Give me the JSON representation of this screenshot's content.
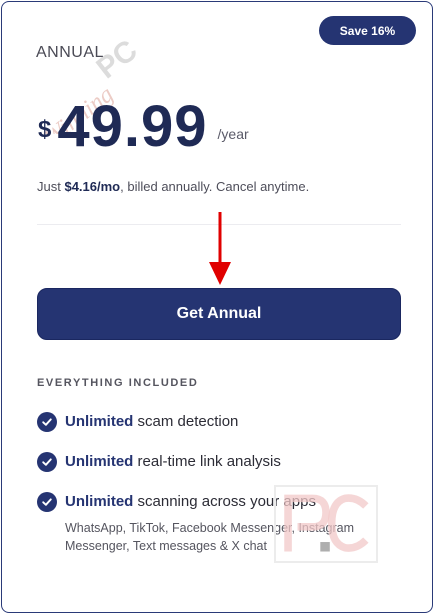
{
  "badge": {
    "label": "Save 16%"
  },
  "plan": {
    "name": "ANNUAL",
    "currency": "$",
    "price": "49.99",
    "period": "/year",
    "subtext_prefix": "Just ",
    "monthly_price": "$4.16/mo",
    "subtext_suffix": ", billed annually. Cancel anytime."
  },
  "cta": {
    "label": "Get Annual"
  },
  "included": {
    "title": "EVERYTHING INCLUDED",
    "features": [
      {
        "highlight": "Unlimited",
        "text": " scam detection"
      },
      {
        "highlight": "Unlimited",
        "text": " real-time link analysis"
      },
      {
        "highlight": "Unlimited",
        "text": " scanning across your apps",
        "subtext": "WhatsApp, TikTok, Facebook Messenger, Instagram Messenger, Text messages & X chat"
      }
    ]
  },
  "watermarks": {
    "text_logo": "WinningPC",
    "corner_logo": "PC"
  },
  "colors": {
    "brand": "#253472",
    "arrow": "#e00000",
    "text": "#2c2c36",
    "border": "#2a3a78"
  },
  "icons": {
    "check": "check-circle-icon",
    "arrow": "arrow-down-icon"
  }
}
